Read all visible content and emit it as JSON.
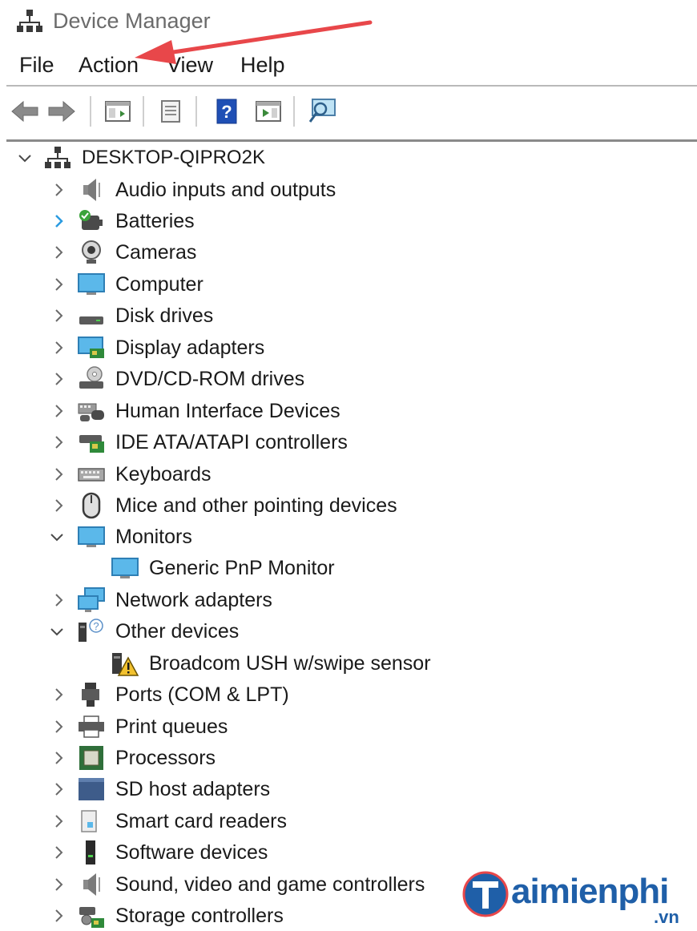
{
  "window": {
    "title": "Device Manager"
  },
  "menu": {
    "file": "File",
    "action": "Action",
    "view": "View",
    "help": "Help"
  },
  "toolbar": {
    "buttons": [
      "back-icon",
      "forward-icon",
      "show-hide-console-tree-icon",
      "properties-icon",
      "help-icon",
      "run-icon",
      "scan-hardware-icon"
    ]
  },
  "tree": {
    "root": "DESKTOP-QIPRO2K",
    "items": [
      {
        "label": "Audio inputs and outputs",
        "icon": "speaker-icon"
      },
      {
        "label": "Batteries",
        "icon": "battery-icon"
      },
      {
        "label": "Cameras",
        "icon": "camera-icon"
      },
      {
        "label": "Computer",
        "icon": "computer-icon"
      },
      {
        "label": "Disk drives",
        "icon": "disk-drive-icon"
      },
      {
        "label": "Display adapters",
        "icon": "display-adapter-icon"
      },
      {
        "label": "DVD/CD-ROM drives",
        "icon": "dvd-drive-icon"
      },
      {
        "label": "Human Interface Devices",
        "icon": "hid-icon"
      },
      {
        "label": "IDE ATA/ATAPI controllers",
        "icon": "ide-controller-icon"
      },
      {
        "label": "Keyboards",
        "icon": "keyboard-icon"
      },
      {
        "label": "Mice and other pointing devices",
        "icon": "mouse-icon"
      },
      {
        "label": "Monitors",
        "icon": "monitor-icon",
        "expanded": true
      },
      {
        "label": "Generic PnP Monitor",
        "icon": "monitor-icon",
        "child": true
      },
      {
        "label": "Network adapters",
        "icon": "network-adapter-icon"
      },
      {
        "label": "Other devices",
        "icon": "unknown-device-icon",
        "expanded": true
      },
      {
        "label": "Broadcom USH w/swipe sensor",
        "icon": "warning-device-icon",
        "child": true
      },
      {
        "label": "Ports (COM & LPT)",
        "icon": "port-icon"
      },
      {
        "label": "Print queues",
        "icon": "printer-icon"
      },
      {
        "label": "Processors",
        "icon": "processor-icon"
      },
      {
        "label": "SD host adapters",
        "icon": "sd-adapter-icon"
      },
      {
        "label": "Smart card readers",
        "icon": "smart-card-icon"
      },
      {
        "label": "Software devices",
        "icon": "software-device-icon"
      },
      {
        "label": "Sound, video and game controllers",
        "icon": "sound-controller-icon"
      },
      {
        "label": "Storage controllers",
        "icon": "storage-controller-icon"
      }
    ]
  },
  "watermark": {
    "brand": "aimienphi",
    "suffix": ".vn"
  },
  "colors": {
    "accent": "#e8474a",
    "chevron_active": "#2b9be0",
    "brand": "#1f5fa8"
  }
}
